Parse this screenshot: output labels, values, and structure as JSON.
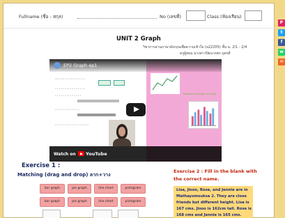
{
  "header": {
    "fullname_label": "Fullname (ชื่อ - สกุล)",
    "no_label": "No (เลขที่)",
    "class_label": "Class (ห้องเรียน)"
  },
  "title": {
    "unit": "UNIT 2 Graph",
    "subject_line": "วิชาการอ่านภาษาอังกฤษเพื่อความเข้าใจ (อ22205) ชั้น ม. 2/1 - 2/4",
    "teacher_line": "ครูผู้สอน  นางสาวปิยนาถพร  บุตรดี"
  },
  "video": {
    "title": "EP2 Graph ep1",
    "watch_on": "Watch on",
    "platform": "YouTube",
    "chart_caption": "Number of Visitors to Shop"
  },
  "exercise1": {
    "title": "Exercise 1 :",
    "subtitle": "Matching (drag and drop) ลาก+วาง",
    "tiles_row1": [
      "bar graph",
      "pie graph",
      "line chart",
      "pictogram"
    ],
    "tiles_row2": [
      "bar graph",
      "pie graph",
      "line chart",
      "pictogram"
    ]
  },
  "exercise2": {
    "title_line1": "Exercise 2 : Fill in the blank with",
    "title_line2": "the correct name.",
    "lines": [
      "Lisa, Jisoo, Rose, and Jennie are in",
      "Mathayomsuksa 2. They are close",
      "friends but different height. Lisa is",
      "167 cms. Jisoo is 162cm tall. Rose is",
      "168 cms and Jennie is 165 cms."
    ]
  },
  "share_rail": {
    "colors": [
      "#e0245e",
      "#1da1f2",
      "#3b5998",
      "#25d366",
      "#f26522"
    ],
    "icons": [
      "pinterest-icon",
      "twitter-icon",
      "facebook-icon",
      "whatsapp-icon",
      "email-icon"
    ]
  }
}
